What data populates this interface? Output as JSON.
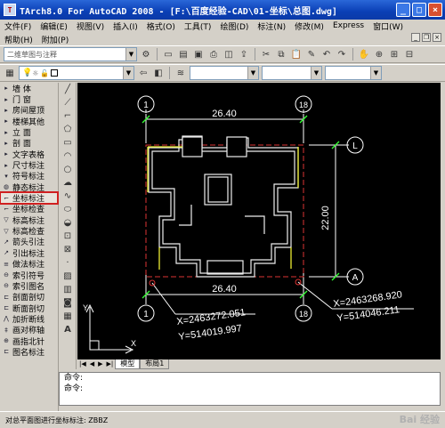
{
  "window": {
    "title": "TArch8.0 For AutoCAD 2008 - [F:\\百度经验-CAD\\01-坐标\\总图.dwg]"
  },
  "menu": {
    "row1": [
      "文件(F)",
      "编辑(E)",
      "视图(V)",
      "插入(I)",
      "格式(O)",
      "工具(T)",
      "绘图(D)",
      "标注(N)",
      "修改(M)",
      "Express",
      "窗口(W)"
    ],
    "row2": [
      "帮助(H)",
      "附加(P)"
    ]
  },
  "toolbar": {
    "workspace_combo": "二维草图与注释"
  },
  "sidebar": {
    "items": [
      {
        "label": "墙   体",
        "icon": "▸"
      },
      {
        "label": "门   窗",
        "icon": "▸"
      },
      {
        "label": "房间屋顶",
        "icon": "▸"
      },
      {
        "label": "楼梯其他",
        "icon": "▸"
      },
      {
        "label": "立   面",
        "icon": "▸"
      },
      {
        "label": "剖   面",
        "icon": "▸"
      },
      {
        "label": "文字表格",
        "icon": "▸"
      },
      {
        "label": "尺寸标注",
        "icon": "▸"
      },
      {
        "label": "符号标注",
        "icon": "▾"
      },
      {
        "label": "静态标注",
        "icon": "◍"
      },
      {
        "label": "坐标标注",
        "icon": "⌐",
        "highlighted": true
      },
      {
        "label": "坐标检查",
        "icon": "⌐"
      },
      {
        "label": "标高标注",
        "icon": "▽"
      },
      {
        "label": "标高检查",
        "icon": "▽"
      },
      {
        "label": "箭头引注",
        "icon": "↗"
      },
      {
        "label": "引出标注",
        "icon": "↗"
      },
      {
        "label": "做法标注",
        "icon": "≡"
      },
      {
        "label": "索引符号",
        "icon": "⊖"
      },
      {
        "label": "索引图名",
        "icon": "⊖"
      },
      {
        "label": "剖面剖切",
        "icon": "⊏"
      },
      {
        "label": "断面剖切",
        "icon": "⊏"
      },
      {
        "label": "加折断线",
        "icon": "⋀"
      },
      {
        "label": "画对称轴",
        "icon": "‡"
      },
      {
        "label": "画指北针",
        "icon": "⊕"
      },
      {
        "label": "图名标注",
        "icon": "⊏"
      }
    ]
  },
  "drawing": {
    "dim_top": "26.40",
    "dim_bottom": "26.40",
    "dim_right": "22.00",
    "axis_1_top": "1",
    "axis_18_top": "18",
    "axis_1_bottom": "1",
    "axis_18_bottom": "18",
    "axis_L": "L",
    "axis_A": "A",
    "coord1_x": "X=2463272.051",
    "coord1_y": "Y=514019.997",
    "coord2_x": "X=2463268.920",
    "coord2_y": "Y=514046.211",
    "ucs_x": "X",
    "ucs_y": "Y"
  },
  "tabs": [
    "模型",
    "布局1"
  ],
  "command": {
    "line1": "命令:",
    "line2": "命令:"
  },
  "status": {
    "text": "对总平面图进行坐标标注: ZBBZ"
  },
  "watermark": "Bai 经验"
}
